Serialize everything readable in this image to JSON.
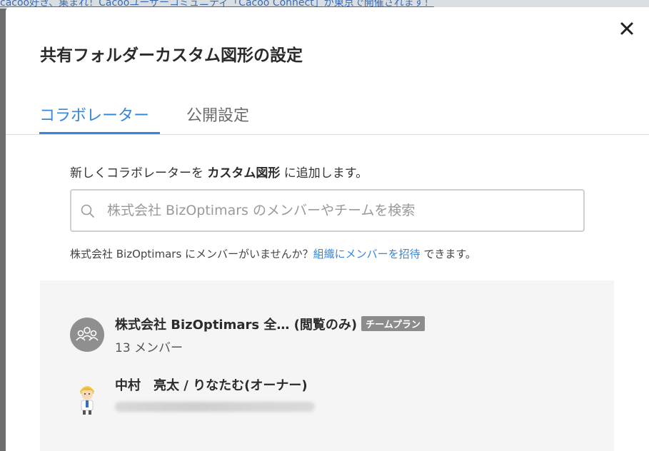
{
  "background": {
    "banner_text": "cacoo好き、集まれ！Cacooユーザーコミュニティ「Cacoo Connect」が東京で開催されます！"
  },
  "modal": {
    "title": "共有フォルダーカスタム図形の設定",
    "close_label": "×",
    "tabs": [
      {
        "label": "コラボレーター",
        "active": true
      },
      {
        "label": "公開設定",
        "active": false
      }
    ],
    "intro": {
      "prefix": "新しくコラボレーターを ",
      "target": "カスタム図形",
      "suffix": " に追加します。"
    },
    "search": {
      "placeholder": "株式会社 BizOptimars のメンバーやチームを検索",
      "value": ""
    },
    "invite": {
      "prefix": "株式会社 BizOptimars にメンバーがいませんか？",
      "link": "組織にメンバーを招待",
      "suffix": " できます。"
    },
    "members": [
      {
        "name": "株式会社 BizOptimars 全…",
        "role": "(閲覧のみ)",
        "badge": "チームプラン",
        "sub": "13 メンバー",
        "avatar": "team-icon"
      },
      {
        "name": "中村　亮太 / りなたむ",
        "role": "(オーナー)",
        "avatar": "user-avatar"
      }
    ]
  },
  "colors": {
    "accent": "#3587dc",
    "badge": "#8c8c8c",
    "panel": "#f5f5f5"
  }
}
